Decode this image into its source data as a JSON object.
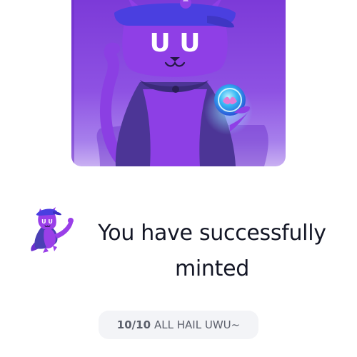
{
  "nft": {
    "face_text": "U U"
  },
  "message": {
    "headline": "You have successfully minted"
  },
  "status": {
    "count": "10/10",
    "text": "ALL HAIL UWU~"
  },
  "colors": {
    "brand_purple": "#7b2fe0",
    "card_background": "#8a4fe0",
    "cap_blue": "#4a3fe0",
    "orb_cyan": "#2fb0f0",
    "headline_text": "#141726",
    "pill_background": "#f3f4f7",
    "pill_text": "#5b5f6b"
  }
}
